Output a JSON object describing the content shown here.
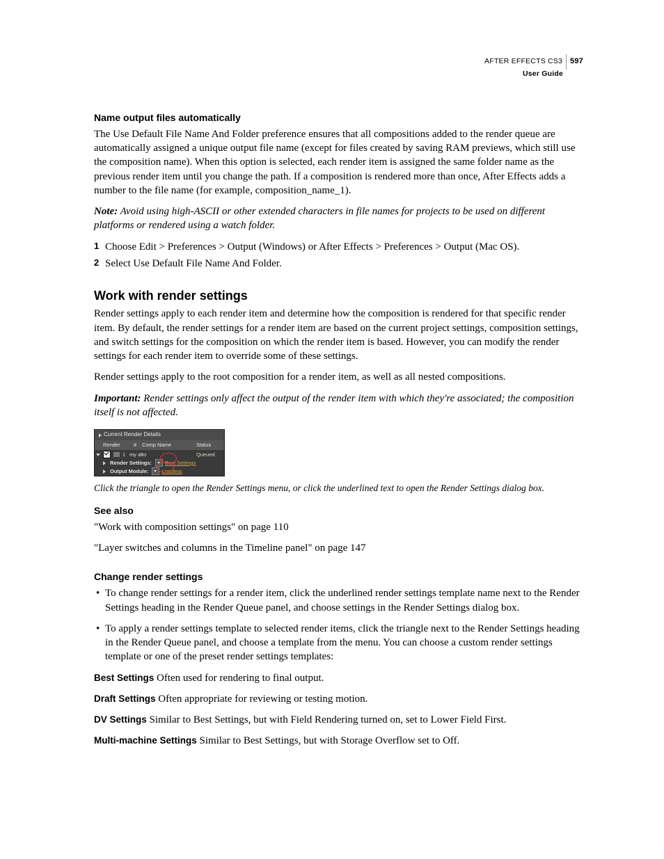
{
  "header": {
    "product": "AFTER EFFECTS CS3",
    "subtitle": "User Guide",
    "page_number": "597"
  },
  "section1": {
    "heading": "Name output files automatically",
    "para1": "The Use Default File Name And Folder preference ensures that all compositions added to the render queue are automatically assigned a unique output file name (except for files created by saving RAM previews, which still use the composition name). When this option is selected, each render item is assigned the same folder name as the previous render item until you change the path. If a composition is rendered more than once, After Effects adds a number to the file name (for example, composition_name_1).",
    "note_label": "Note:",
    "note_text": " Avoid using high-ASCII or other extended characters in file names for projects to be used on different platforms or rendered using a watch folder.",
    "steps": [
      "Choose Edit > Preferences > Output (Windows) or After Effects > Preferences > Output (Mac OS).",
      "Select Use Default File Name And Folder."
    ]
  },
  "section2": {
    "heading": "Work with render settings",
    "para1": "Render settings apply to each render item and determine how the composition is rendered for that specific render item. By default, the render settings for a render item are based on the current project settings, composition settings, and switch settings for the composition on which the render item is based. However, you can modify the render settings for each render item to override some of these settings.",
    "para2": "Render settings apply to the root composition for a render item, as well as all nested compositions.",
    "important_label": "Important:",
    "important_text": " Render settings only affect the output of the render item with which they're associated; the composition itself is not affected.",
    "caption": "Click the triangle to open the Render Settings menu, or click the underlined text to open the Render Settings dialog box."
  },
  "figure": {
    "panel_title": "Current Render Details",
    "col_render": "Render",
    "col_icon": "",
    "col_hash": "#",
    "col_comp": "Comp Name",
    "col_status": "Status",
    "item_index": "1",
    "item_name": "my alto",
    "item_status": "Queued",
    "rs_label": "Render Settings:",
    "rs_value": "Best Settings",
    "om_label": "Output Module:",
    "om_value": "Lossless"
  },
  "see_also": {
    "heading": "See also",
    "link1": "\"Work with composition settings\" on page 110",
    "link2": "\"Layer switches and columns in the Timeline panel\" on page 147"
  },
  "section3": {
    "heading": "Change render settings",
    "bullets": [
      "To change render settings for a render item, click the underlined render settings template name next to the Render Settings heading in the Render Queue panel, and choose settings in the Render Settings dialog box.",
      "To apply a render settings template to selected render items, click the triangle next to the Render Settings heading in the Render Queue panel, and choose a template from the menu. You can choose a custom render settings template or one of the preset render settings templates:"
    ],
    "defs": [
      {
        "term": "Best Settings",
        "text": "  Often used for rendering to final output."
      },
      {
        "term": "Draft Settings",
        "text": "  Often appropriate for reviewing or testing motion."
      },
      {
        "term": "DV Settings",
        "text": "  Similar to Best Settings, but with Field Rendering turned on, set to Lower Field First."
      },
      {
        "term": "Multi-machine Settings",
        "text": "  Similar to Best Settings, but with Storage Overflow set to Off."
      }
    ]
  }
}
